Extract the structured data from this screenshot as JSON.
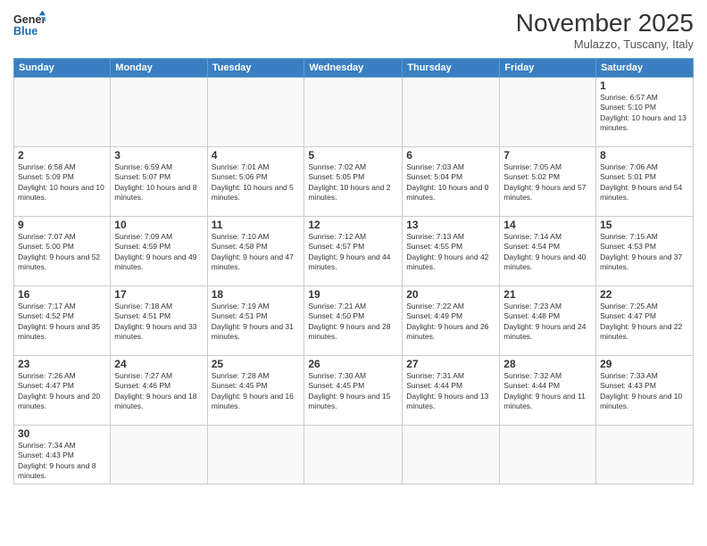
{
  "header": {
    "logo_general": "General",
    "logo_blue": "Blue",
    "month_title": "November 2025",
    "subtitle": "Mulazzo, Tuscany, Italy"
  },
  "weekdays": [
    "Sunday",
    "Monday",
    "Tuesday",
    "Wednesday",
    "Thursday",
    "Friday",
    "Saturday"
  ],
  "days": {
    "1": {
      "sunrise": "6:57 AM",
      "sunset": "5:10 PM",
      "daylight": "10 hours and 13 minutes."
    },
    "2": {
      "sunrise": "6:58 AM",
      "sunset": "5:09 PM",
      "daylight": "10 hours and 10 minutes."
    },
    "3": {
      "sunrise": "6:59 AM",
      "sunset": "5:07 PM",
      "daylight": "10 hours and 8 minutes."
    },
    "4": {
      "sunrise": "7:01 AM",
      "sunset": "5:06 PM",
      "daylight": "10 hours and 5 minutes."
    },
    "5": {
      "sunrise": "7:02 AM",
      "sunset": "5:05 PM",
      "daylight": "10 hours and 2 minutes."
    },
    "6": {
      "sunrise": "7:03 AM",
      "sunset": "5:04 PM",
      "daylight": "10 hours and 0 minutes."
    },
    "7": {
      "sunrise": "7:05 AM",
      "sunset": "5:02 PM",
      "daylight": "9 hours and 57 minutes."
    },
    "8": {
      "sunrise": "7:06 AM",
      "sunset": "5:01 PM",
      "daylight": "9 hours and 54 minutes."
    },
    "9": {
      "sunrise": "7:07 AM",
      "sunset": "5:00 PM",
      "daylight": "9 hours and 52 minutes."
    },
    "10": {
      "sunrise": "7:09 AM",
      "sunset": "4:59 PM",
      "daylight": "9 hours and 49 minutes."
    },
    "11": {
      "sunrise": "7:10 AM",
      "sunset": "4:58 PM",
      "daylight": "9 hours and 47 minutes."
    },
    "12": {
      "sunrise": "7:12 AM",
      "sunset": "4:57 PM",
      "daylight": "9 hours and 44 minutes."
    },
    "13": {
      "sunrise": "7:13 AM",
      "sunset": "4:55 PM",
      "daylight": "9 hours and 42 minutes."
    },
    "14": {
      "sunrise": "7:14 AM",
      "sunset": "4:54 PM",
      "daylight": "9 hours and 40 minutes."
    },
    "15": {
      "sunrise": "7:15 AM",
      "sunset": "4:53 PM",
      "daylight": "9 hours and 37 minutes."
    },
    "16": {
      "sunrise": "7:17 AM",
      "sunset": "4:52 PM",
      "daylight": "9 hours and 35 minutes."
    },
    "17": {
      "sunrise": "7:18 AM",
      "sunset": "4:51 PM",
      "daylight": "9 hours and 33 minutes."
    },
    "18": {
      "sunrise": "7:19 AM",
      "sunset": "4:51 PM",
      "daylight": "9 hours and 31 minutes."
    },
    "19": {
      "sunrise": "7:21 AM",
      "sunset": "4:50 PM",
      "daylight": "9 hours and 28 minutes."
    },
    "20": {
      "sunrise": "7:22 AM",
      "sunset": "4:49 PM",
      "daylight": "9 hours and 26 minutes."
    },
    "21": {
      "sunrise": "7:23 AM",
      "sunset": "4:48 PM",
      "daylight": "9 hours and 24 minutes."
    },
    "22": {
      "sunrise": "7:25 AM",
      "sunset": "4:47 PM",
      "daylight": "9 hours and 22 minutes."
    },
    "23": {
      "sunrise": "7:26 AM",
      "sunset": "4:47 PM",
      "daylight": "9 hours and 20 minutes."
    },
    "24": {
      "sunrise": "7:27 AM",
      "sunset": "4:46 PM",
      "daylight": "9 hours and 18 minutes."
    },
    "25": {
      "sunrise": "7:28 AM",
      "sunset": "4:45 PM",
      "daylight": "9 hours and 16 minutes."
    },
    "26": {
      "sunrise": "7:30 AM",
      "sunset": "4:45 PM",
      "daylight": "9 hours and 15 minutes."
    },
    "27": {
      "sunrise": "7:31 AM",
      "sunset": "4:44 PM",
      "daylight": "9 hours and 13 minutes."
    },
    "28": {
      "sunrise": "7:32 AM",
      "sunset": "4:44 PM",
      "daylight": "9 hours and 11 minutes."
    },
    "29": {
      "sunrise": "7:33 AM",
      "sunset": "4:43 PM",
      "daylight": "9 hours and 10 minutes."
    },
    "30": {
      "sunrise": "7:34 AM",
      "sunset": "4:43 PM",
      "daylight": "9 hours and 8 minutes."
    }
  }
}
